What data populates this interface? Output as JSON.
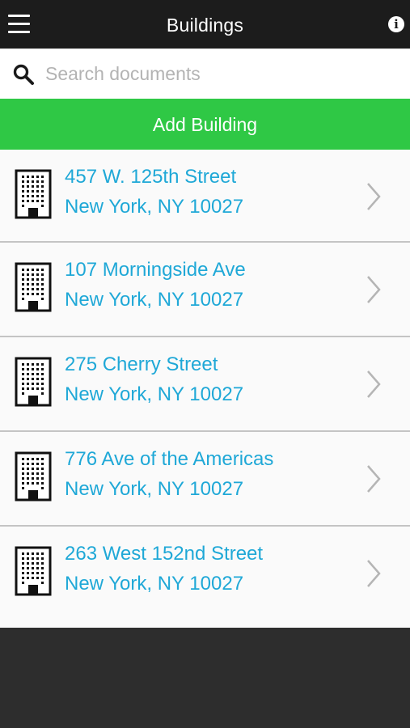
{
  "header": {
    "title": "Buildings",
    "menu_icon": "hamburger-menu-icon",
    "info_icon": "info-circle-icon",
    "info_glyph": "i"
  },
  "search": {
    "placeholder": "Search documents",
    "value": "",
    "icon": "search-icon"
  },
  "add_button": {
    "label": "Add Building",
    "color": "#2fc845"
  },
  "buildings": [
    {
      "line1": "457 W. 125th Street",
      "line2": "New York, NY 10027"
    },
    {
      "line1": "107 Morningside Ave",
      "line2": "New York, NY 10027"
    },
    {
      "line1": "275 Cherry Street",
      "line2": "New York, NY 10027"
    },
    {
      "line1": "776 Ave of the Americas",
      "line2": "New York, NY 10027"
    },
    {
      "line1": "263 West 152nd Street",
      "line2": "New York, NY 10027"
    }
  ],
  "colors": {
    "header_bg": "#1c1c1c",
    "link_text": "#1fa8d7",
    "footer_bg": "#2d2d2d"
  }
}
